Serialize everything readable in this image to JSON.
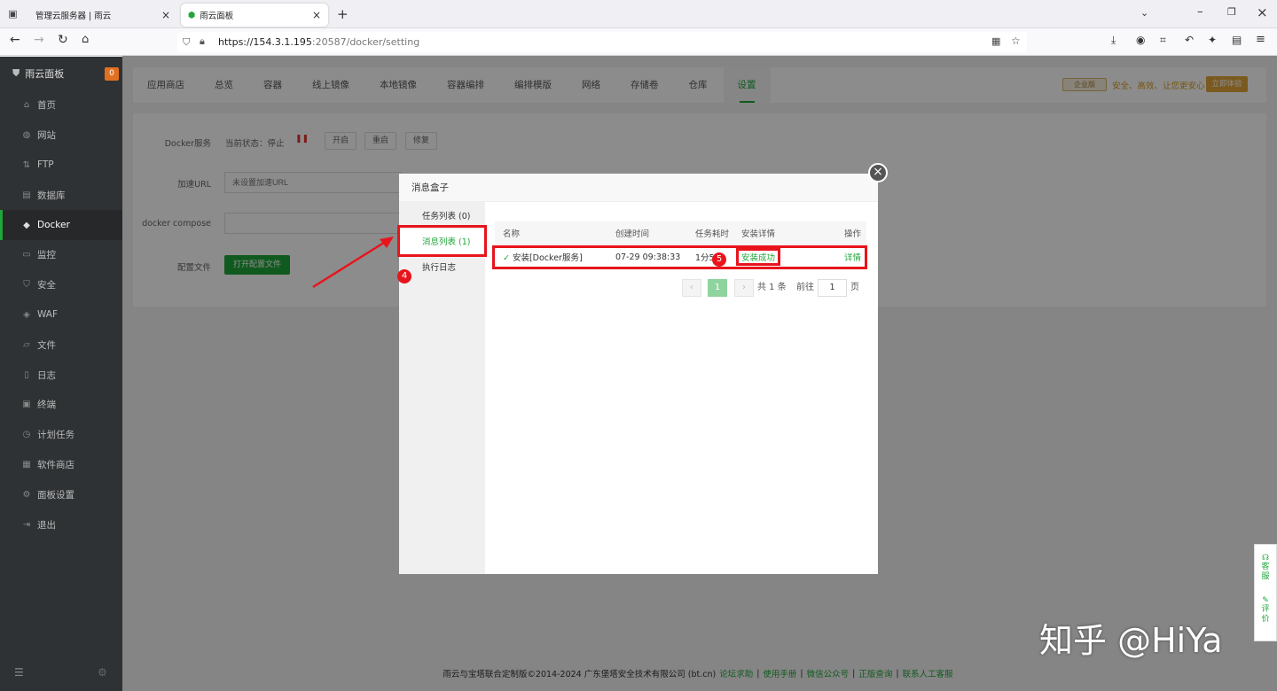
{
  "browser": {
    "tabs": [
      {
        "title": "管理云服务器 | 雨云"
      },
      {
        "title": "雨云面板"
      }
    ],
    "url_main": "https://154.3.1.195",
    "url_rest": ":20587/docker/setting"
  },
  "sidebar": {
    "title": "雨云面板",
    "badge": "0",
    "items": [
      {
        "label": "首页",
        "icon": "home-icon"
      },
      {
        "label": "网站",
        "icon": "globe-icon"
      },
      {
        "label": "FTP",
        "icon": "ftp-icon"
      },
      {
        "label": "数据库",
        "icon": "database-icon"
      },
      {
        "label": "Docker",
        "icon": "docker-icon"
      },
      {
        "label": "监控",
        "icon": "monitor-icon"
      },
      {
        "label": "安全",
        "icon": "shield-icon"
      },
      {
        "label": "WAF",
        "icon": "waf-icon"
      },
      {
        "label": "文件",
        "icon": "folder-icon"
      },
      {
        "label": "日志",
        "icon": "log-icon"
      },
      {
        "label": "终端",
        "icon": "terminal-icon"
      },
      {
        "label": "计划任务",
        "icon": "clock-icon"
      },
      {
        "label": "软件商店",
        "icon": "store-icon"
      },
      {
        "label": "面板设置",
        "icon": "gear-icon"
      },
      {
        "label": "退出",
        "icon": "logout-icon"
      }
    ]
  },
  "nav": {
    "tabs": [
      "应用商店",
      "总览",
      "容器",
      "线上镜像",
      "本地镜像",
      "容器编排",
      "编排模版",
      "网络",
      "存储卷",
      "仓库",
      "设置"
    ]
  },
  "promo": {
    "badge": "企业版",
    "text": "安全、高效、让您更安心",
    "button": "立即体验"
  },
  "settings": {
    "docker_label": "Docker服务",
    "status_label": "当前状态：停止",
    "btn_start": "开启",
    "btn_restart": "重启",
    "btn_repair": "修复",
    "accel_label": "加速URL",
    "accel_placeholder": "未设置加速URL",
    "compose_label": "docker compose",
    "config_label": "配置文件",
    "config_button": "打开配置文件"
  },
  "modal": {
    "title": "消息盒子",
    "tabs": [
      "任务列表 (0)",
      "消息列表 (1)",
      "执行日志"
    ],
    "columns": [
      "名称",
      "创建时间",
      "任务耗时",
      "安装详情",
      "操作"
    ],
    "rows": [
      {
        "name": "安装[Docker服务]",
        "time": "07-29 09:38:33",
        "duration": "1分5",
        "status": "安装成功",
        "action": "详情"
      }
    ],
    "pager": {
      "current": "1",
      "total": "共 1 条",
      "goto": "前往",
      "page_input": "1",
      "page_unit": "页"
    }
  },
  "annotations": {
    "n4": "4",
    "n5": "5"
  },
  "footer": {
    "copyright": "雨云与宝塔联合定制版©2014-2024 广东堡塔安全技术有限公司 (bt.cn)",
    "links": [
      "论坛求助",
      "使用手册",
      "微信公众号",
      "正版查询",
      "联系人工客服"
    ]
  },
  "float": {
    "service": "客服",
    "review": "评价"
  },
  "watermark": "知乎 @HiYa",
  "colors": {
    "accent": "#20a53a",
    "annotation": "#e8141c"
  }
}
